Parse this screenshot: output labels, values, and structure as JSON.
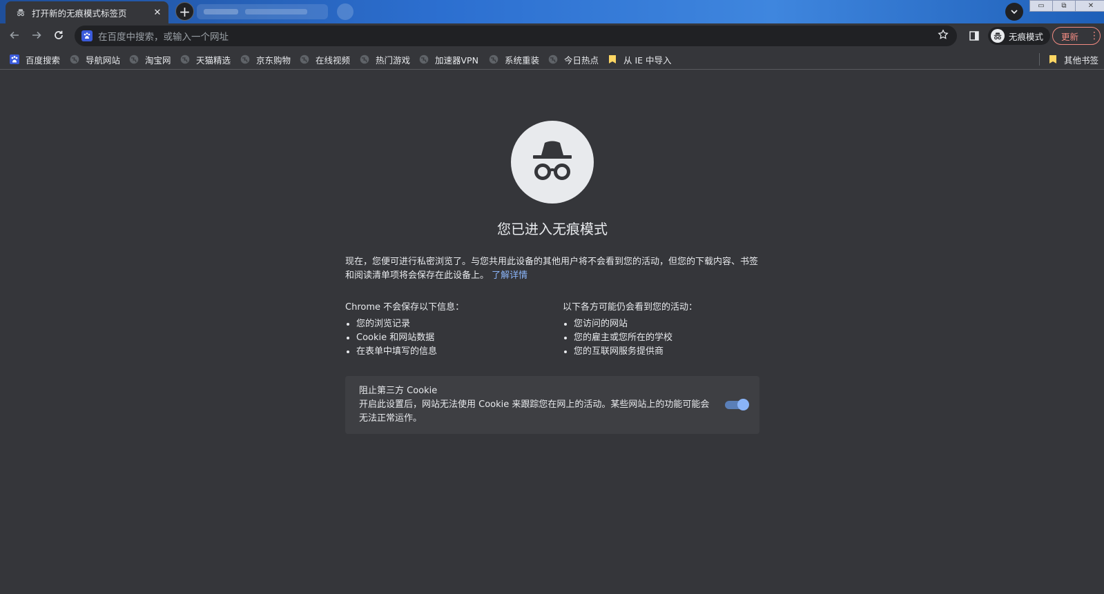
{
  "tabs": {
    "active_title": "打开新的无痕模式标签页",
    "close_glyph": "✕",
    "new_tab_glyph": "+"
  },
  "window_controls": {
    "minimize": "▭",
    "restore": "⧉",
    "close": "✕"
  },
  "toolbar": {
    "omnibox_placeholder": "在百度中搜索，或输入一个网址",
    "incognito_label": "无痕模式",
    "update_label": "更新",
    "menu_glyph": "⋮",
    "star_icon": "star-icon"
  },
  "bookmarks": {
    "items": [
      {
        "label": "百度搜索",
        "icon": "baidu-icon"
      },
      {
        "label": "导航网站",
        "icon": "globe-icon"
      },
      {
        "label": "淘宝网",
        "icon": "globe-icon"
      },
      {
        "label": "天猫精选",
        "icon": "globe-icon"
      },
      {
        "label": "京东购物",
        "icon": "globe-icon"
      },
      {
        "label": "在线视频",
        "icon": "globe-icon"
      },
      {
        "label": "热门游戏",
        "icon": "globe-icon"
      },
      {
        "label": "加速器VPN",
        "icon": "globe-icon"
      },
      {
        "label": "系统重装",
        "icon": "globe-icon"
      },
      {
        "label": "今日热点",
        "icon": "globe-icon"
      },
      {
        "label": "从 IE 中导入",
        "icon": "folder-icon"
      }
    ],
    "other": {
      "label": "其他书签",
      "icon": "folder-icon"
    }
  },
  "main": {
    "heading": "您已进入无痕模式",
    "intro": "现在，您便可进行私密浏览了。与您共用此设备的其他用户将不会看到您的活动，但您的下载内容、书签和阅读清单项将会保存在此设备上。",
    "learn_more": "了解详情",
    "left_column": {
      "title": "Chrome 不会保存以下信息：",
      "items": [
        "您的浏览记录",
        "Cookie 和网站数据",
        "在表单中填写的信息"
      ]
    },
    "right_column": {
      "title": "以下各方可能仍会看到您的活动：",
      "items": [
        "您访问的网站",
        "您的雇主或您所在的学校",
        "您的互联网服务提供商"
      ]
    },
    "cookie_card": {
      "title": "阻止第三方 Cookie",
      "description": "开启此设置后，网站无法使用 Cookie 来跟踪您在网上的活动。某些网站上的功能可能会无法正常运作。",
      "toggle_on": true
    }
  },
  "colors": {
    "background": "#35363a",
    "link": "#8ab4f8",
    "update_accent": "#f28b82"
  }
}
